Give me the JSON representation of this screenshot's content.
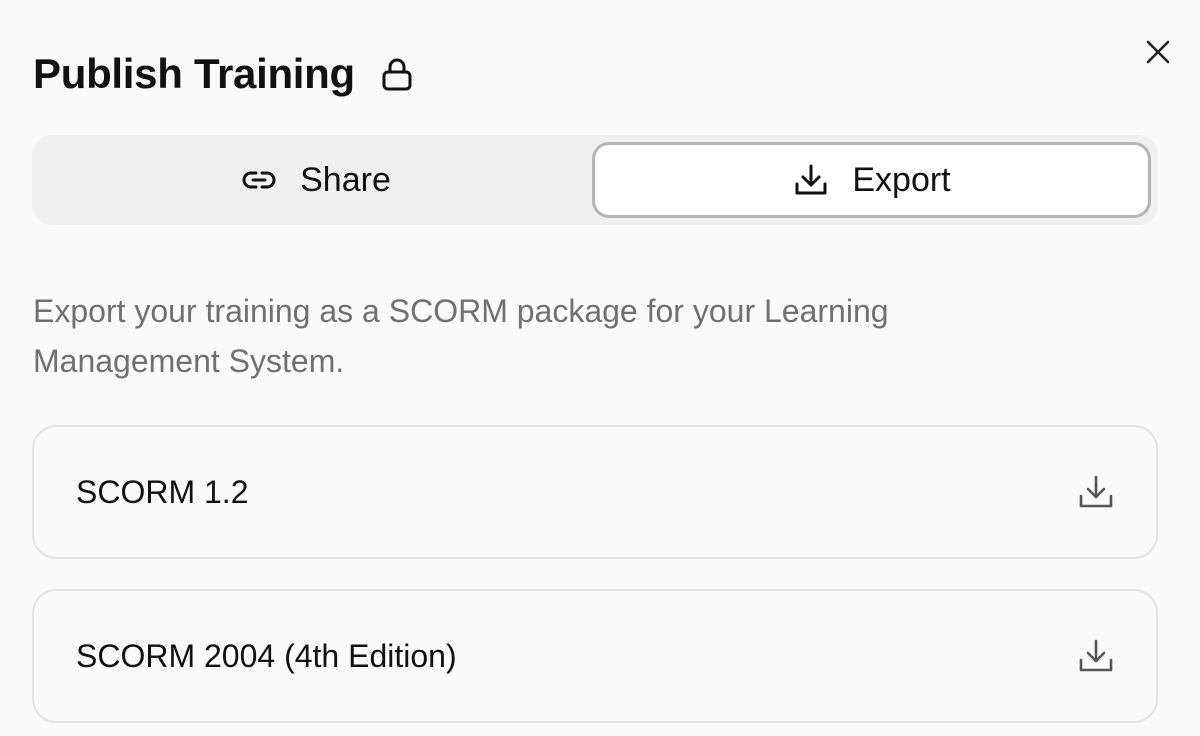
{
  "dialog": {
    "title": "Publish Training",
    "title_icon": "lock-icon",
    "close_icon": "close-icon"
  },
  "tabs": [
    {
      "label": "Share",
      "icon": "link-icon",
      "active": false
    },
    {
      "label": "Export",
      "icon": "download-icon",
      "active": true
    }
  ],
  "export": {
    "description": "Export your training as a SCORM package for your Learning Management System.",
    "options": [
      {
        "label": "SCORM 1.2",
        "icon": "download-icon"
      },
      {
        "label": "SCORM 2004 (4th Edition)",
        "icon": "download-icon"
      }
    ]
  },
  "colors": {
    "background": "#fafafa",
    "segment_track": "#f0f0f0",
    "active_border": "#b5b5b5",
    "muted_text": "#707070",
    "card_border": "#e3e3e3"
  }
}
